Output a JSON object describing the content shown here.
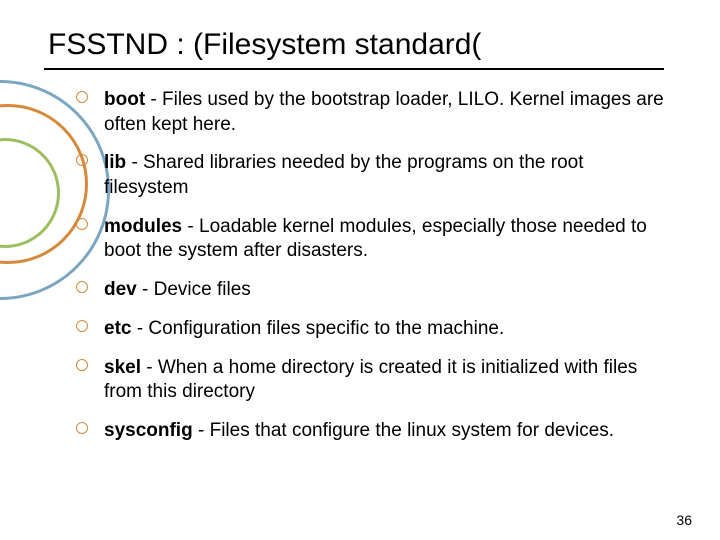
{
  "title": "FSSTND : (Filesystem standard(",
  "bullets": [
    {
      "term": "boot",
      "desc": " - Files used by the bootstrap loader, LILO. Kernel images are often kept here."
    },
    {
      "term": "lib",
      "desc": " - Shared libraries needed by the programs on the root filesystem"
    },
    {
      "term": "modules",
      "desc": " - Loadable kernel modules, especially those needed to boot the system after disasters."
    },
    {
      "term": "dev",
      "desc": " - Device files"
    },
    {
      "term": "etc",
      "desc": " - Configuration files specific to the machine."
    },
    {
      "term": "skel",
      "desc": " - When a home directory is created it is initialized with files from this directory"
    },
    {
      "term": "sysconfig",
      "desc": " - Files that configure the linux system for devices."
    }
  ],
  "page_number": "36"
}
